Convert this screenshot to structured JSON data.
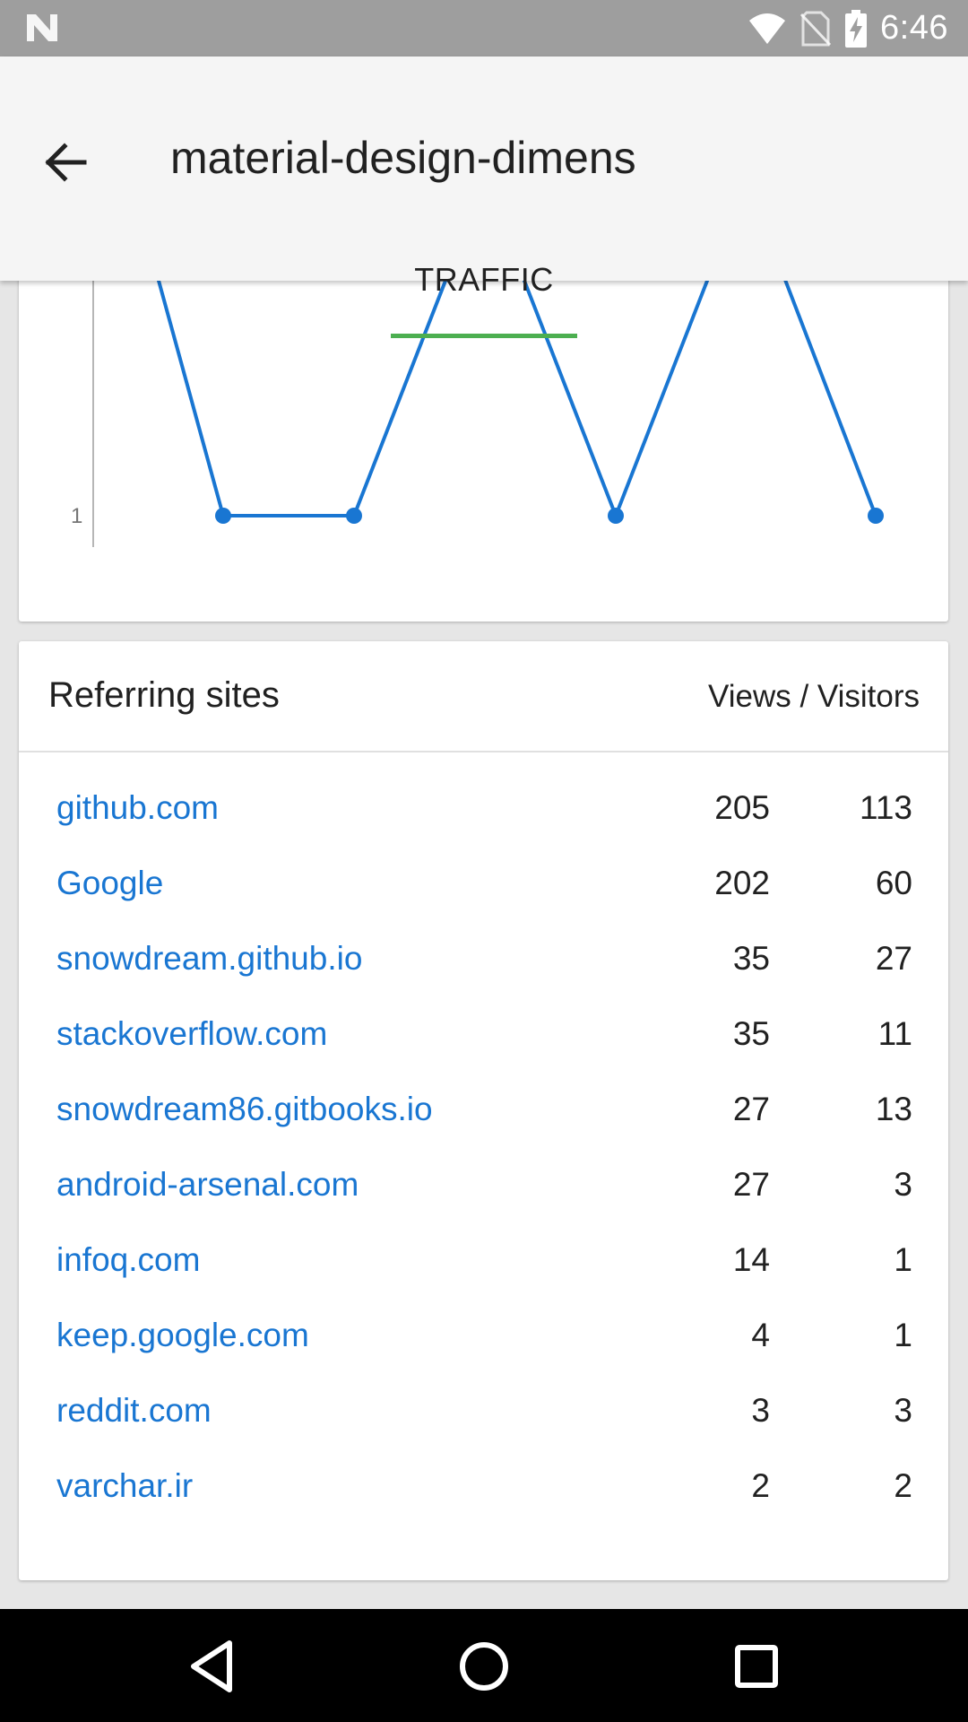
{
  "status_bar": {
    "time": "6:46",
    "icons": [
      "n-logo-icon",
      "wifi-icon",
      "no-sim-icon",
      "battery-charging-icon"
    ]
  },
  "app_bar": {
    "title": "material-design-dimens",
    "tabs": [
      {
        "label": "TRAFFIC",
        "selected": true
      }
    ],
    "accent_color": "#4caf50"
  },
  "chart_data": {
    "type": "line",
    "series_color": "#1976d2",
    "y_tick_labels": [
      "1"
    ],
    "points": [
      {
        "y": null,
        "marker": false
      },
      {
        "y": 1,
        "marker": true
      },
      {
        "y": 1,
        "marker": true
      },
      {
        "y": null,
        "marker": false
      },
      {
        "y": 1,
        "marker": true
      },
      {
        "y": null,
        "marker": false
      },
      {
        "y": 1,
        "marker": true
      }
    ],
    "note": "upper part of chart scrolled out of view; values above 1 not visible"
  },
  "referring_sites": {
    "title": "Referring sites",
    "columns_label": "Views / Visitors",
    "link_color": "#1976d2",
    "rows": [
      {
        "site": "github.com",
        "views": "205",
        "visitors": "113"
      },
      {
        "site": "Google",
        "views": "202",
        "visitors": "60"
      },
      {
        "site": "snowdream.github.io",
        "views": "35",
        "visitors": "27"
      },
      {
        "site": "stackoverflow.com",
        "views": "35",
        "visitors": "11"
      },
      {
        "site": "snowdream86.gitbooks.io",
        "views": "27",
        "visitors": "13"
      },
      {
        "site": "android-arsenal.com",
        "views": "27",
        "visitors": "3"
      },
      {
        "site": "infoq.com",
        "views": "14",
        "visitors": "1"
      },
      {
        "site": "keep.google.com",
        "views": "4",
        "visitors": "1"
      },
      {
        "site": "reddit.com",
        "views": "3",
        "visitors": "3"
      },
      {
        "site": "varchar.ir",
        "views": "2",
        "visitors": "2"
      }
    ]
  },
  "nav_bar": {
    "buttons": [
      "back-nav-icon",
      "home-nav-icon",
      "recents-nav-icon"
    ]
  }
}
